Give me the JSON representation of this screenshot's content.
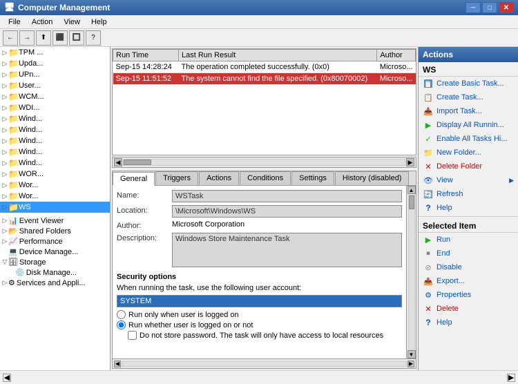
{
  "window": {
    "title": "Computer Management",
    "icon": "🖥"
  },
  "menu": {
    "items": [
      "File",
      "Action",
      "View",
      "Help"
    ]
  },
  "toolbar": {
    "buttons": [
      "←",
      "→",
      "⬆",
      "⬛",
      "🔲",
      "📋"
    ]
  },
  "sidebar": {
    "items": [
      {
        "label": "TPM ...",
        "level": 2,
        "expanded": false
      },
      {
        "label": "Upda...",
        "level": 2,
        "expanded": false
      },
      {
        "label": "UPn...",
        "level": 2,
        "expanded": false
      },
      {
        "label": "User...",
        "level": 2,
        "expanded": false
      },
      {
        "label": "WCM...",
        "level": 2,
        "expanded": false
      },
      {
        "label": "WDI...",
        "level": 2,
        "expanded": false
      },
      {
        "label": "Wind...",
        "level": 2,
        "expanded": false
      },
      {
        "label": "Wind...",
        "level": 2,
        "expanded": false
      },
      {
        "label": "Wind...",
        "level": 2,
        "expanded": false
      },
      {
        "label": "Wind...",
        "level": 2,
        "expanded": false
      },
      {
        "label": "Wind...",
        "level": 2,
        "expanded": false
      },
      {
        "label": "WOR...",
        "level": 2,
        "expanded": false
      },
      {
        "label": "Wor...",
        "level": 2,
        "expanded": false
      },
      {
        "label": "Wor...",
        "level": 2,
        "expanded": false
      },
      {
        "label": "WS",
        "level": 2,
        "expanded": false,
        "selected": true
      },
      {
        "label": "Event Viewer",
        "level": 1,
        "expanded": false
      },
      {
        "label": "Shared Folders",
        "level": 1,
        "expanded": false
      },
      {
        "label": "Performance",
        "level": 1,
        "expanded": false
      },
      {
        "label": "Device Manage...",
        "level": 1,
        "expanded": false
      },
      {
        "label": "Storage",
        "level": 0,
        "expanded": true
      },
      {
        "label": "Disk Manage...",
        "level": 1,
        "expanded": false
      },
      {
        "label": "Services and Appli...",
        "level": 1,
        "expanded": false
      }
    ]
  },
  "task_table": {
    "columns": [
      "Run Time",
      "Last Run Result",
      "Author"
    ],
    "rows": [
      {
        "run_time": "Sep-15 14:28:24",
        "result": "The operation completed successfully. (0x0)",
        "author": "Microso...",
        "type": "normal"
      },
      {
        "run_time": "Sep-15 11:51:52",
        "result": "The system cannot find the file specified. (0x80070002)",
        "author": "Microso...",
        "type": "error"
      }
    ]
  },
  "detail_tabs": {
    "tabs": [
      "General",
      "Triggers",
      "Actions",
      "Conditions",
      "Settings",
      "History (disabled)"
    ],
    "active": "General"
  },
  "general_tab": {
    "name_label": "Name:",
    "name_value": "WSTask",
    "location_label": "Location:",
    "location_value": "\\Microsoft\\Windows\\WS",
    "author_label": "Author:",
    "author_value": "Microsoft Corporation",
    "description_label": "Description:",
    "description_value": "Windows Store Maintenance Task",
    "security_header": "Security options",
    "security_text": "When running the task, use the following user account:",
    "security_account": "SYSTEM",
    "radio1": "Run only when user is logged on",
    "radio2": "Run whether user is logged on or not",
    "checkbox1": "Do not store password.  The task will only have access to local resources"
  },
  "actions_panel": {
    "header": "Actions",
    "ws_section": "WS",
    "items_top": [
      {
        "label": "Create Basic Task...",
        "icon": "📋",
        "color": "#0055cc"
      },
      {
        "label": "Create Task...",
        "icon": "📋",
        "color": "#0055cc"
      },
      {
        "label": "Import Task...",
        "icon": "📥",
        "color": "#0055cc"
      },
      {
        "label": "Display All Runnin...",
        "icon": "▶",
        "color": "#0055cc"
      },
      {
        "label": "Enable All Tasks Hi...",
        "icon": "✓",
        "color": "#0055cc"
      },
      {
        "label": "New Folder...",
        "icon": "📁",
        "color": "#0055cc"
      },
      {
        "label": "Delete Folder",
        "icon": "✕",
        "color": "#cc0000"
      },
      {
        "label": "View",
        "icon": "👁",
        "color": "#0055cc",
        "hasSubmenu": true
      },
      {
        "label": "Refresh",
        "icon": "🔄",
        "color": "#0055cc"
      },
      {
        "label": "Help",
        "icon": "?",
        "color": "#0055cc"
      }
    ],
    "selected_section": "Selected Item",
    "items_selected": [
      {
        "label": "Run",
        "icon": "▶",
        "color": "#0055cc"
      },
      {
        "label": "End",
        "icon": "⏹",
        "color": "#0055cc"
      },
      {
        "label": "Disable",
        "icon": "⊘",
        "color": "#0055cc"
      },
      {
        "label": "Export...",
        "icon": "📤",
        "color": "#0055cc"
      },
      {
        "label": "Properties",
        "icon": "⚙",
        "color": "#0055cc"
      },
      {
        "label": "Delete",
        "icon": "✕",
        "color": "#cc0000"
      },
      {
        "label": "Help",
        "icon": "?",
        "color": "#0055cc"
      }
    ]
  }
}
